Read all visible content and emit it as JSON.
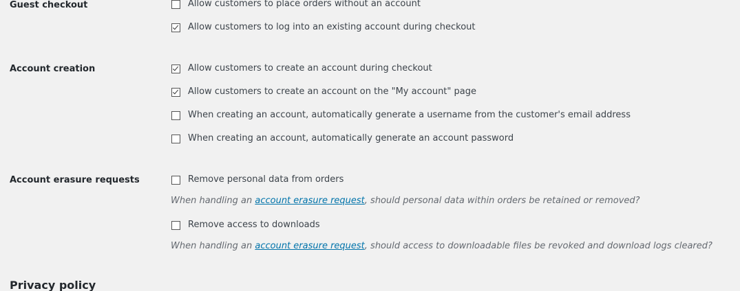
{
  "guest_checkout": {
    "label": "Guest checkout",
    "options": [
      {
        "label": "Allow customers to place orders without an account",
        "checked": false
      },
      {
        "label": "Allow customers to log into an existing account during checkout",
        "checked": true
      }
    ]
  },
  "account_creation": {
    "label": "Account creation",
    "options": [
      {
        "label": "Allow customers to create an account during checkout",
        "checked": true
      },
      {
        "label": "Allow customers to create an account on the \"My account\" page",
        "checked": true
      },
      {
        "label": "When creating an account, automatically generate a username from the customer's email address",
        "checked": false
      },
      {
        "label": "When creating an account, automatically generate an account password",
        "checked": false
      }
    ]
  },
  "account_erasure": {
    "label": "Account erasure requests",
    "remove_orders": {
      "label": "Remove personal data from orders",
      "checked": false,
      "desc_prefix": "When handling an ",
      "desc_link": "account erasure request",
      "desc_suffix": ", should personal data within orders be retained or removed?"
    },
    "remove_downloads": {
      "label": "Remove access to downloads",
      "checked": false,
      "desc_prefix": "When handling an ",
      "desc_link": "account erasure request",
      "desc_suffix": ", should access to downloadable files be revoked and download logs cleared?"
    }
  },
  "privacy_policy": {
    "heading": "Privacy policy"
  },
  "colors": {
    "background": "#f1f1f1",
    "link": "#0073aa",
    "text": "#23282d",
    "description": "#646970"
  }
}
